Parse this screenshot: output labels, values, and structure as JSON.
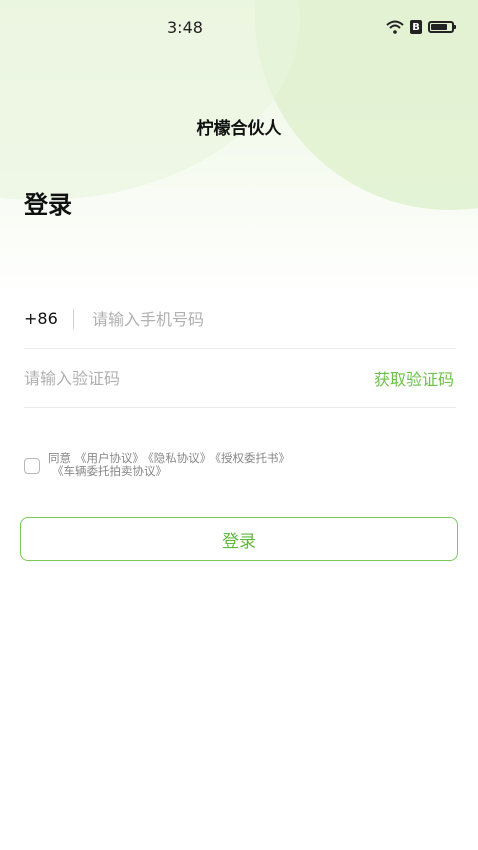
{
  "status_bar": {
    "time": "3:48",
    "badge": "B"
  },
  "header": {
    "app_title": "柠檬合伙人"
  },
  "page": {
    "heading": "登录"
  },
  "phone": {
    "prefix": "+86",
    "placeholder": "请输入手机号码"
  },
  "code": {
    "placeholder": "请输入验证码",
    "get_code_label": "获取验证码"
  },
  "agreement": {
    "prefix": "同意",
    "links": [
      "《用户协议》",
      "《隐私协议》",
      "《授权委托书》",
      "《车辆委托拍卖协议》"
    ]
  },
  "login_button": {
    "label": "登录"
  },
  "colors": {
    "accent": "#6cc24a",
    "accent_border": "#7dc95a",
    "background_tint": "#dff1cf"
  }
}
